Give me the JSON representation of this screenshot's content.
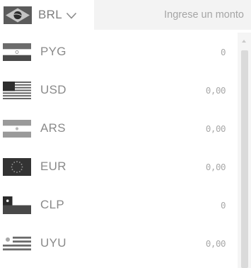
{
  "header": {
    "selected_currency": "BRL",
    "flag_icon": "brazil-flag-icon",
    "amount_placeholder": "Ingrese un monto"
  },
  "rows": [
    {
      "code": "PYG",
      "value": "0",
      "flag": "paraguay-flag-icon"
    },
    {
      "code": "USD",
      "value": "0,00",
      "flag": "usa-flag-icon"
    },
    {
      "code": "ARS",
      "value": "0,00",
      "flag": "argentina-flag-icon"
    },
    {
      "code": "EUR",
      "value": "0,00",
      "flag": "eu-flag-icon"
    },
    {
      "code": "CLP",
      "value": "0",
      "flag": "chile-flag-icon"
    },
    {
      "code": "UYU",
      "value": "0,00",
      "flag": "uruguay-flag-icon"
    }
  ]
}
